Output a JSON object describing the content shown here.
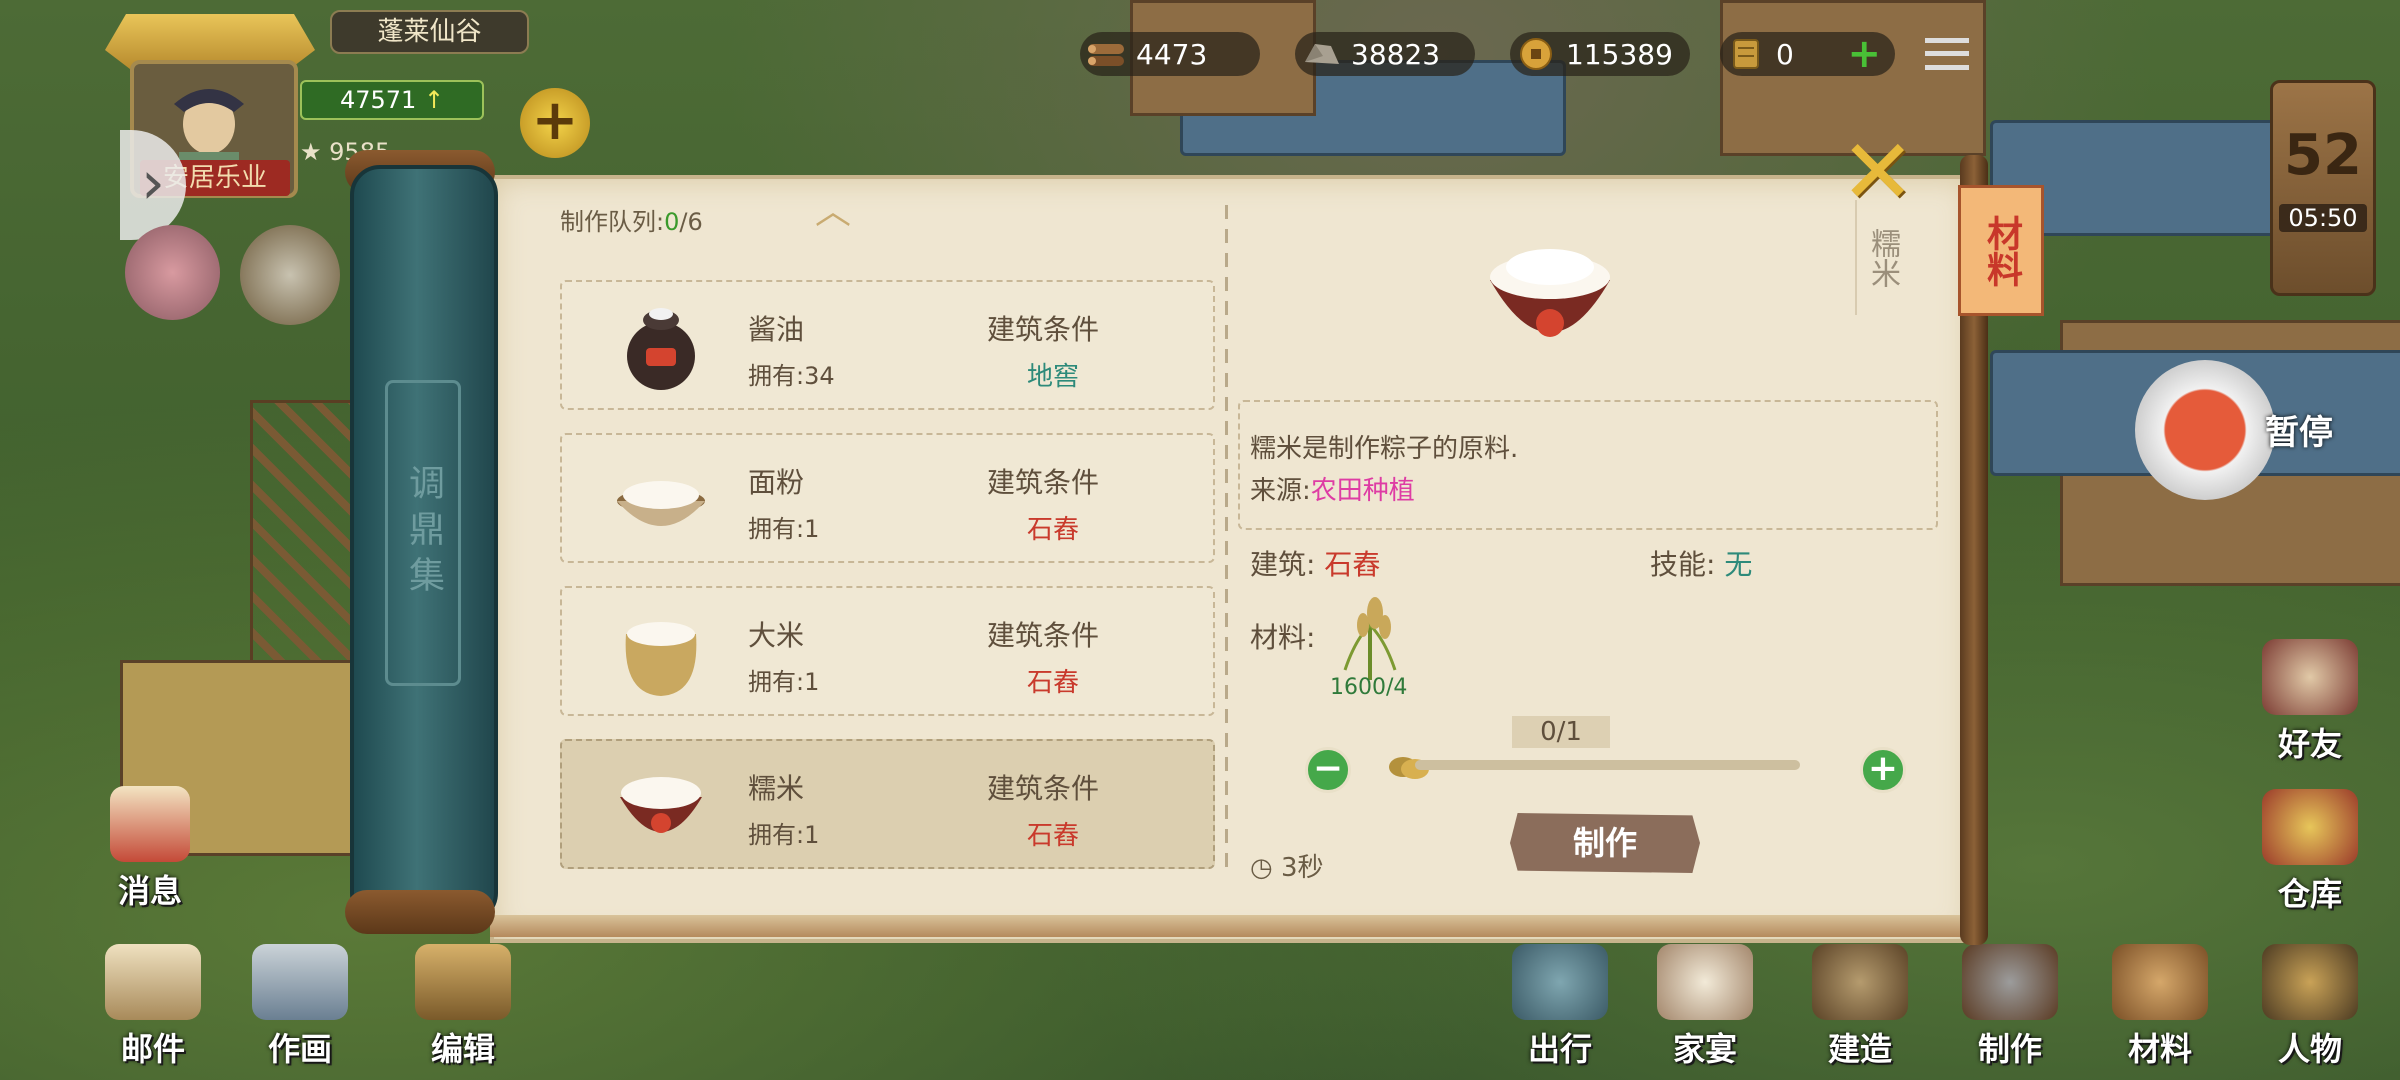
{
  "top": {
    "location": "蓬莱仙谷",
    "stat_main": "47571",
    "stat_sub": "9585",
    "player_name": "安居乐业",
    "resources": [
      {
        "name": "wood",
        "value": "4473"
      },
      {
        "name": "stone",
        "value": "38823"
      },
      {
        "name": "coins",
        "value": "115389"
      },
      {
        "name": "tickets",
        "value": "0"
      }
    ]
  },
  "timer": {
    "day": "52",
    "clock": "05:50"
  },
  "pause_label": "暂停",
  "side_left": {
    "messages": "消息"
  },
  "side_right": {
    "friends": "好友",
    "warehouse": "仓库"
  },
  "bottom_left": [
    {
      "id": "mail",
      "label": "邮件"
    },
    {
      "id": "paint",
      "label": "作画"
    },
    {
      "id": "edit",
      "label": "编辑"
    }
  ],
  "bottom_right": [
    {
      "id": "travel",
      "label": "出行"
    },
    {
      "id": "banquet",
      "label": "家宴"
    },
    {
      "id": "build",
      "label": "建造"
    },
    {
      "id": "craft",
      "label": "制作"
    },
    {
      "id": "material",
      "label": "材料"
    },
    {
      "id": "people",
      "label": "人物"
    }
  ],
  "panel": {
    "rod_title": "调鼎集",
    "queue_label": "制作队列:",
    "queue_current": "0",
    "queue_total": "/6",
    "tab_label": "材料",
    "recipes": [
      {
        "name": "酱油",
        "owned": "拥有:34",
        "cond_label": "建筑条件",
        "building": "地窖",
        "building_color": "#2d8a7a"
      },
      {
        "name": "面粉",
        "owned": "拥有:1",
        "cond_label": "建筑条件",
        "building": "石舂",
        "building_color": "#c93a2c"
      },
      {
        "name": "大米",
        "owned": "拥有:1",
        "cond_label": "建筑条件",
        "building": "石舂",
        "building_color": "#c93a2c"
      },
      {
        "name": "糯米",
        "owned": "拥有:1",
        "cond_label": "建筑条件",
        "building": "石舂",
        "building_color": "#c93a2c"
      }
    ],
    "detail": {
      "name": "糯米",
      "description": "糯米是制作粽子的原料.",
      "source_label": "来源:",
      "source_value": "农田种植",
      "building_label": "建筑:",
      "building_value": "石舂",
      "skill_label": "技能:",
      "skill_value": "无",
      "material_label": "材料:",
      "material_count": "1600/4",
      "quantity": "0/1",
      "make_label": "制作",
      "time": "3秒"
    }
  },
  "colors": {
    "accent_green": "#3b9a2c",
    "red_text": "#c93a2c",
    "pink_text": "#de3ca4",
    "teal_text": "#2d8a7a"
  }
}
